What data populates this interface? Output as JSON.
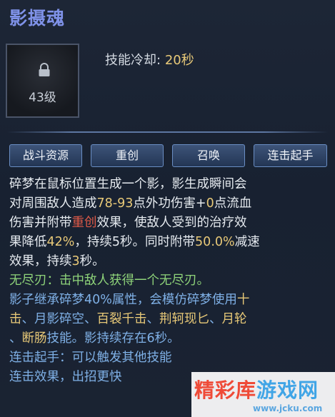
{
  "skill": {
    "name": "影摄魂",
    "icon_level": "43级",
    "cooldown_label": "技能冷却:",
    "cooldown_value": "20秒"
  },
  "tags": [
    "战斗资源",
    "重创",
    "召唤",
    "连击起手"
  ],
  "description": {
    "l1": "碎梦在鼠标位置生成一个影，影生成瞬间会",
    "l2a": "对周围敌人造成",
    "l2b": "78",
    "l2c": "-",
    "l2d": "93",
    "l2e": "点外功伤害+",
    "l2f": "0",
    "l2g": "点流血",
    "l3a": "伤害并附带",
    "l3b": "重创",
    "l3c": "效果，使敌人受到的治疗效",
    "l4a": "果降低",
    "l4b": "42%",
    "l4c": "，持续5秒。同时附带",
    "l4d": "50.0%",
    "l4e": "减速",
    "l5a": "效果，持续",
    "l5b": "3",
    "l5c": "秒。",
    "l6": "无尽刃：击中敌人获得一个无尽刃。",
    "l7a": "影子继承碎梦40%属性，会模仿碎梦使用",
    "l7b": "十",
    "l8a": "击",
    "l8b": "、月影碎空、",
    "l8c": "百裂千击",
    "l8d": "、",
    "l8e": "荆轲现匕",
    "l8f": "、",
    "l8g": "月轮",
    "l9a": "、",
    "l9b": "断肠",
    "l9c": "技能。影持续存在6秒。",
    "l10": "连击起手：可以触发其他技能",
    "l11": "连击效果，出招更快"
  },
  "watermark": {
    "part1": "精彩库",
    "part2": "游戏网",
    "url": "www.jcku.com"
  },
  "colors": {
    "title": "#7f92e8",
    "value_orange": "#e8c978",
    "status_red": "#e05a48",
    "green": "#8fd47a",
    "blue": "#7fb0e6"
  }
}
